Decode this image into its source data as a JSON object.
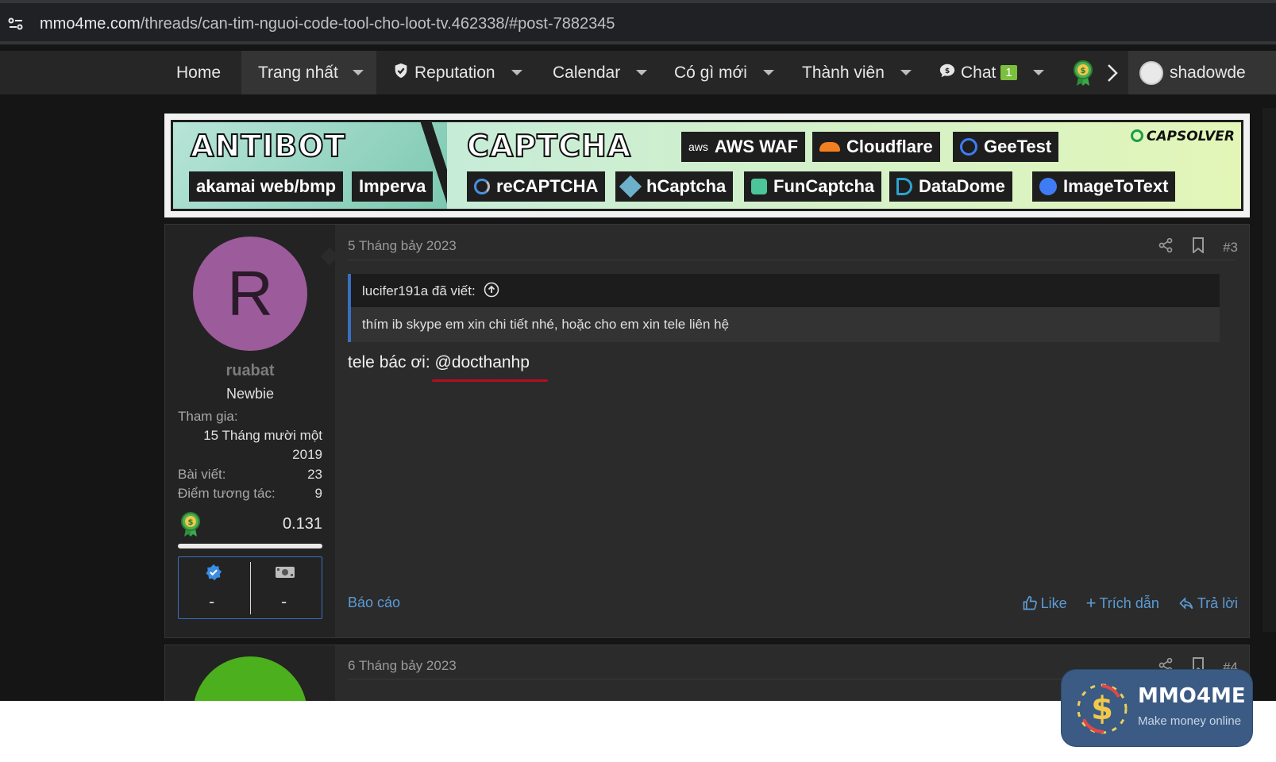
{
  "browser": {
    "url_host": "mmo4me.com",
    "url_path": "/threads/can-tim-nguoi-code-tool-cho-loot-tv.462338/#post-7882345"
  },
  "nav": {
    "home": "Home",
    "trang_nhat": "Trang nhất",
    "reputation": "Reputation",
    "calendar": "Calendar",
    "co_gi_moi": "Có gì mới",
    "thanh_vien": "Thành viên",
    "chat": "Chat",
    "chat_count": "1",
    "username": "shadowde"
  },
  "banner": {
    "left_title": "ANTIBOT",
    "left_tags": [
      "akamai web/bmp",
      "Imperva"
    ],
    "right_title": "CAPTCHA",
    "top_tags": [
      "AWS WAF",
      "Cloudflare",
      "GeeTest"
    ],
    "bottom_tags": [
      "reCAPTCHA",
      "hCaptcha",
      "FunCaptcha",
      "DataDome",
      "ImageToText"
    ],
    "brand": "CAPSOLVER",
    "aws_prefix": "aws"
  },
  "post": {
    "avatar_letter": "R",
    "username": "ruabat",
    "user_title": "Newbie",
    "joined_label": "Tham gia:",
    "joined_value_line1": "15 Tháng mười một",
    "joined_value_line2": "2019",
    "posts_label": "Bài viết:",
    "posts_value": "23",
    "reactions_label": "Điểm tương tác:",
    "reactions_value": "9",
    "reputation_value": "0.131",
    "reputation_fill": 1.0,
    "badge_left": "-",
    "badge_right": "-",
    "date": "5 Tháng bảy 2023",
    "number": "#3",
    "quote_author": "lucifer191a đã viết:",
    "quote_text": "thím ib skype em xin chi tiết nhé, hoặc cho em xin tele liên hệ",
    "message_prefix": "tele bác ơi: ",
    "message_mention": "@docthanhp",
    "report": "Báo cáo",
    "like": "Like",
    "quote_action": "Trích dẫn",
    "reply": "Trả lời"
  },
  "post2": {
    "date": "6 Tháng bảy 2023",
    "number": "#4"
  },
  "watermark": {
    "title": "MMO4ME",
    "subtitle": "Make money online"
  },
  "colors": {
    "link": "#5b9bd6",
    "quote_border": "#3a6fbf",
    "underline": "#b30f1f",
    "avatar": "#9c5b9a",
    "avatar2": "#4caf1e"
  }
}
